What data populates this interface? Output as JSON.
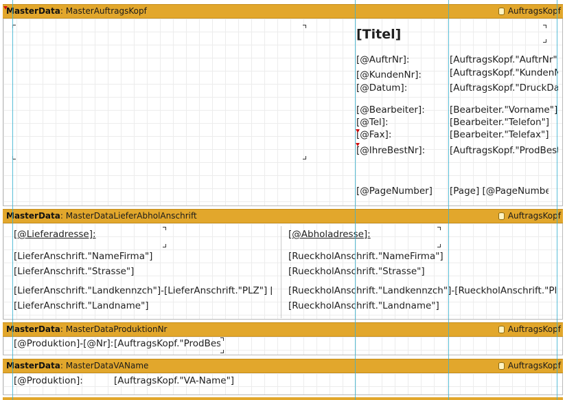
{
  "bands": [
    {
      "type": "MasterData",
      "name": "MasterAuftragsKopf",
      "source": "AuftragsKopf"
    },
    {
      "type": "MasterData",
      "name": "MasterDataLieferAbholAnschrift",
      "source": "AuftragsKopf"
    },
    {
      "type": "MasterData",
      "name": "MasterDataProduktionNr",
      "source": "AuftragsKopf"
    },
    {
      "type": "MasterData",
      "name": "MasterDataVAName",
      "source": "AuftragsKopf"
    }
  ],
  "kopf": {
    "title": "[Titel]",
    "labels": [
      "[@AuftrNr]:",
      "[@KundenNr]:",
      "[@Datum]:",
      "[@Bearbeiter]:",
      "[@Tel]:",
      "[@Fax]:",
      "[@IhreBestNr]:",
      "[@PageNumber]"
    ],
    "values": [
      "[AuftragsKopf.\"AuftrNr\"]",
      "[AuftragsKopf.\"KundenN",
      "[AuftragsKopf.\"DruckDat",
      "[Bearbeiter.\"Vorname\"]",
      "[Bearbeiter.\"Telefon\"]",
      "[Bearbeiter.\"Telefax\"]",
      "[AuftragsKopf.\"ProdBest",
      "[Page] [@PageNumbe"
    ]
  },
  "anschrift": {
    "liefer_header": "[@Lieferadresse]:",
    "abhol_header": "[@Abholadresse]:",
    "liefer_lines": [
      "[LieferAnschrift.\"NameFirma\"]",
      "[LieferAnschrift.\"Strasse\"]",
      "[LieferAnschrift.\"Landkennzch\"]-[LieferAnschrift.\"PLZ\"] [Lie",
      "[LieferAnschrift.\"Landname\"]"
    ],
    "abhol_lines": [
      "[RueckholAnschrift.\"NameFirma\"]",
      "[RueckholAnschrift.\"Strasse\"]",
      "[RueckholAnschrift.\"Landkennzch\"]-[RueckholAnschrift.\"PLZ\"]",
      "[RueckholAnschrift.\"Landname\"]"
    ]
  },
  "produktion": {
    "label": "[@Produktion]-[@Nr]:",
    "value": "[AuftragsKopf.\"ProdBest"
  },
  "vaname": {
    "label": "[@Produktion]:",
    "value": "[AuftragsKopf.\"VA-Name\"]"
  },
  "colors": {
    "band_header": "#e2a72c",
    "guide": "#3bb2d0",
    "grid": "#ececec",
    "marker": "#d01010"
  }
}
